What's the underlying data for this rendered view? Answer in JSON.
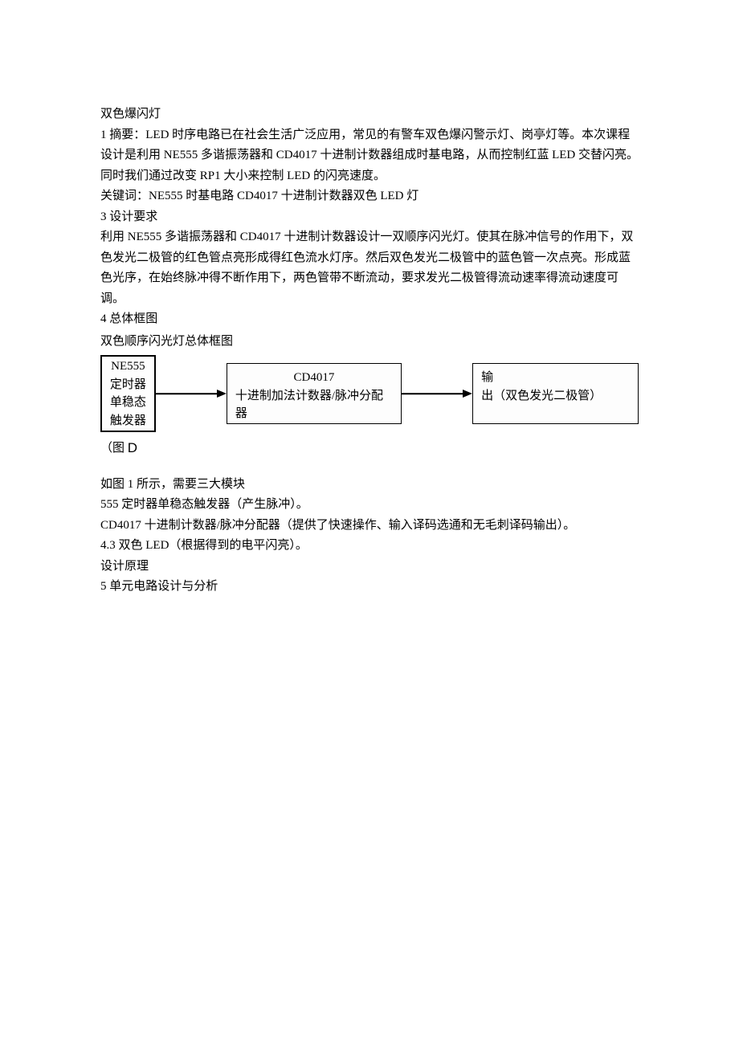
{
  "head": {
    "title": "双色爆闪灯",
    "abstract": "1 摘要：LED 时序电路已在社会生活广泛应用，常见的有警车双色爆闪警示灯、岗亭灯等。本次课程设计是利用 NE555 多谐振荡器和 CD4017 十进制计数器组成时基电路，从而控制红蓝 LED 交替闪亮。同时我们通过改变 RP1 大小来控制 LED 的闪亮速度。",
    "keywords": "关键词：NE555 时基电路 CD4017 十进制计数器双色 LED 灯",
    "requirements_heading": "3 设计要求",
    "requirements_body": "利用 NE555 多谐振荡器和 CD4017 十进制计数器设计一双顺序闪光灯。使其在脉冲信号的作用下，双色发光二极管的红色管点亮形成得红色流水灯序。然后双色发光二极管中的蓝色管一次点亮。形成蓝色光序，在始终脉冲得不断作用下，两色管带不断流动，要求发光二极管得流动速率得流动速度可调。",
    "block_heading": "4 总体框图",
    "block_title": "双色顺序闪光灯总体框图"
  },
  "diagram": {
    "box1_l1": "NE555",
    "box1_l2": "定时器",
    "box1_l3": "单稳态",
    "box1_l4": "触发器",
    "box2_l1": "CD4017",
    "box2_l2": "十进制加法计数器/脉冲分配器",
    "box3_prefix": "输",
    "box3_rest": "出（双色发光二极管）"
  },
  "caption": {
    "text": "（图 ",
    "d": "D"
  },
  "tail": {
    "p1": "如图 1 所示，需要三大模块",
    "p2": "555 定时器单稳态触发器（产生脉冲）。",
    "p3": "CD4017 十进制计数器/脉冲分配器（提供了快速操作、输入译码选通和无毛刺译码输出）。",
    "p4": "4.3 双色 LED（根据得到的电平闪亮）。",
    "p5": "设计原理",
    "p6": "5 单元电路设计与分析"
  }
}
